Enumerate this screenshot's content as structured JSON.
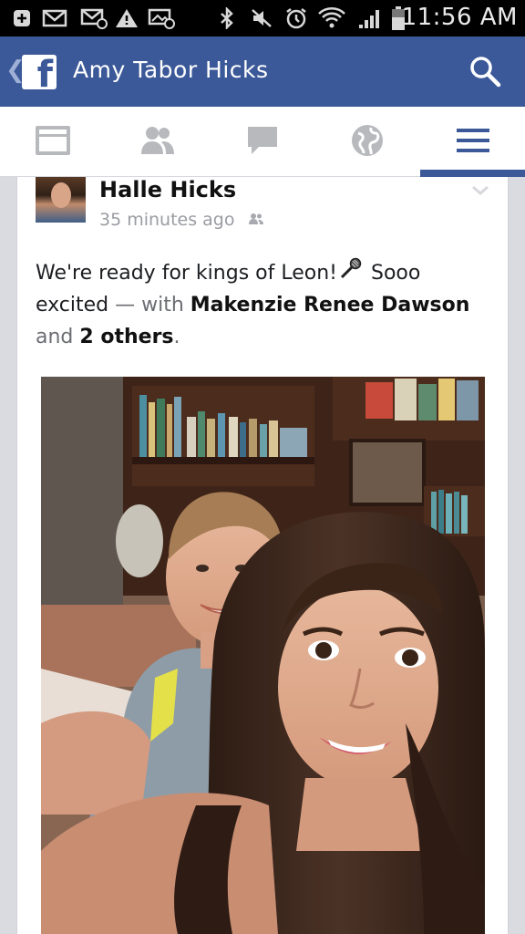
{
  "status_bar": {
    "time": "11:56 AM",
    "icons": [
      "plus-box-icon",
      "mail-icon",
      "email-at-icon",
      "warning-icon",
      "image-mail-icon",
      "bluetooth-icon",
      "mute-icon",
      "alarm-icon",
      "wifi-icon",
      "signal-icon",
      "battery-icon"
    ]
  },
  "header": {
    "title": "Amy Tabor Hicks",
    "logo_letter": "f",
    "brand_color": "#3b5998"
  },
  "tabs": [
    {
      "name": "news-feed",
      "icon": "news-feed-icon",
      "active": false
    },
    {
      "name": "friend-requests",
      "icon": "friends-icon",
      "active": false
    },
    {
      "name": "messages",
      "icon": "chat-bubble-icon",
      "active": false
    },
    {
      "name": "notifications",
      "icon": "globe-icon",
      "active": false
    },
    {
      "name": "more",
      "icon": "menu-icon",
      "active": true
    }
  ],
  "post": {
    "author": "Halle Hicks",
    "time": "35 minutes ago",
    "privacy_icon": "friends-privacy-icon",
    "text_part1": "We're ready for kings of Leon!",
    "text_part2": " Sooo excited",
    "with_prefix": " — with ",
    "tagged": "Makenzie Renee Dawson",
    "and": " and ",
    "others": "2 others",
    "period": "."
  }
}
